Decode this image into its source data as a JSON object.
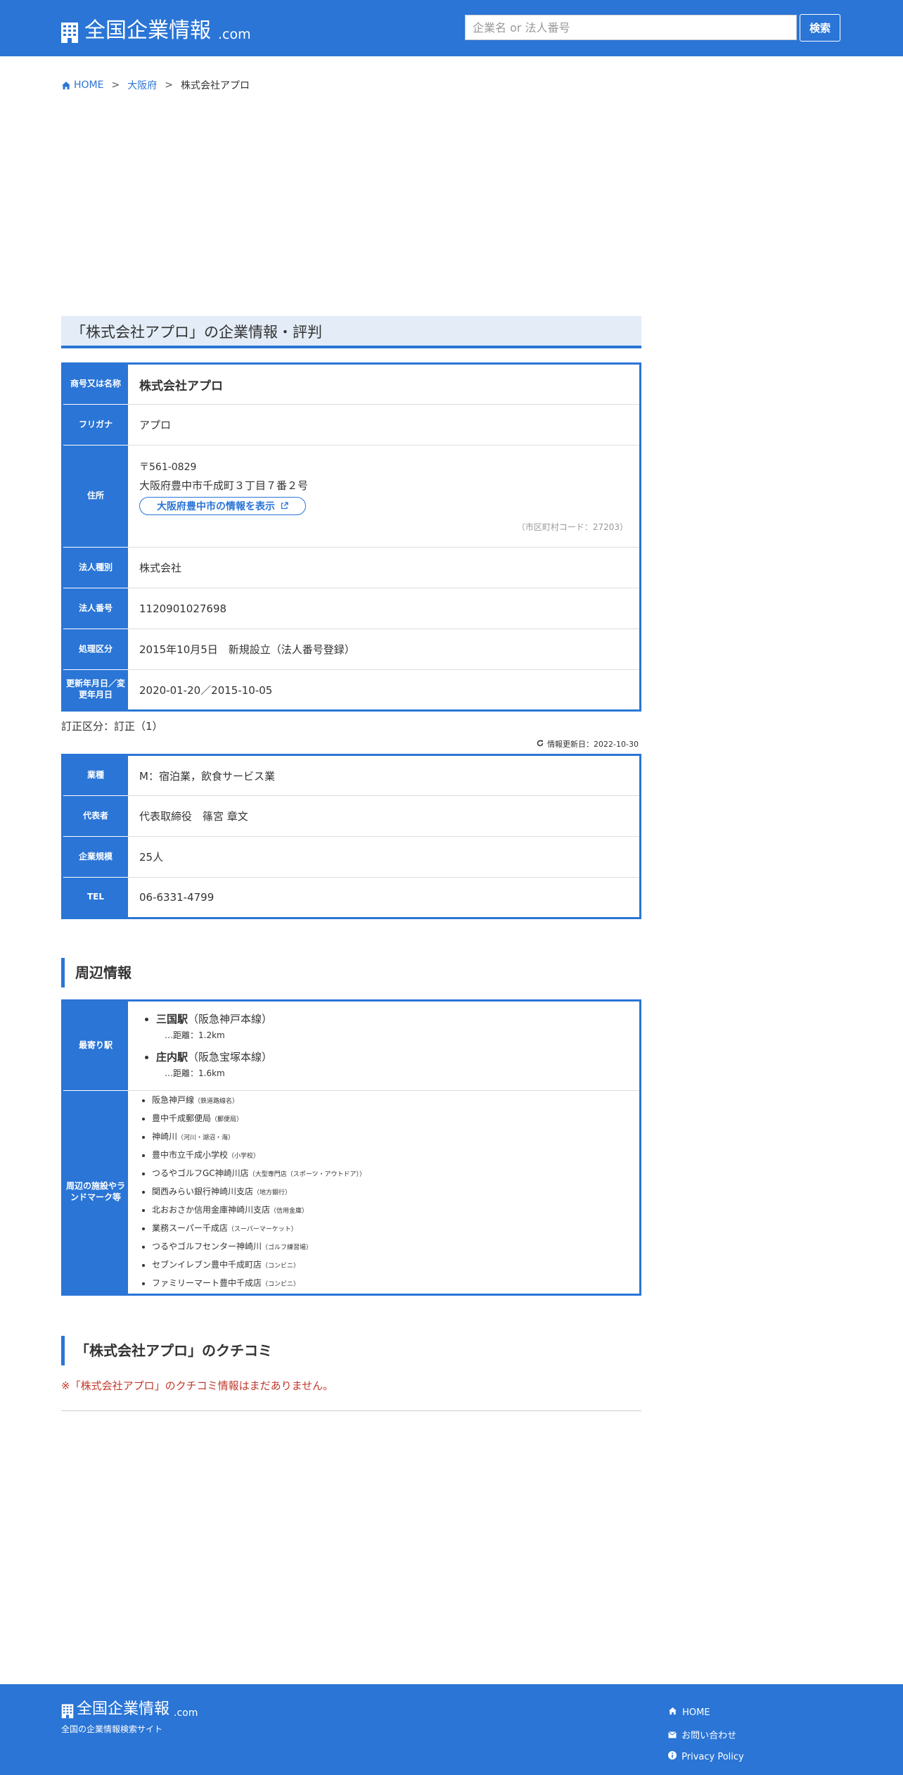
{
  "header": {
    "logo_text": "全国企業情報",
    "logo_suffix": ".com",
    "search_placeholder": "企業名 or 法人番号",
    "search_button": "検索"
  },
  "breadcrumb": {
    "home": "HOME",
    "sep": ">",
    "prefecture": "大阪府",
    "current": "株式会社アプロ"
  },
  "section_title": "「株式会社アプロ」の企業情報・評判",
  "basic": {
    "name_label": "商号又は名称",
    "name": "株式会社アプロ",
    "kana_label": "フリガナ",
    "kana": "アプロ",
    "address_label": "住所",
    "postal": "〒561-0829",
    "address": "大阪府豊中市千成町３丁目７番２号",
    "city_link": "大阪府豊中市の情報を表示",
    "muni_code": "（市区町村コード：27203）",
    "type_label": "法人種別",
    "type": "株式会社",
    "number_label": "法人番号",
    "number": "1120901027698",
    "process_label": "処理区分",
    "process": "2015年10月5日　新規設立（法人番号登録）",
    "updated_label": "更新年月日／変更年月日",
    "updated": "2020-01-20／2015-10-05"
  },
  "correction_note": "訂正区分：訂正（1）",
  "info_updated": "情報更新日：2022-10-30",
  "extra": {
    "industry_label": "業種",
    "industry": "M：宿泊業，飲食サービス業",
    "rep_label": "代表者",
    "rep": "代表取締役　篠宮 章文",
    "size_label": "企業規模",
    "size": "25人",
    "tel_label": "TEL",
    "tel": "06-6331-4799"
  },
  "nearby": {
    "title": "周辺情報",
    "station_label": "最寄り駅",
    "stations": [
      {
        "name": "三国駅",
        "line": "（阪急神戸本線）",
        "dist": "…距離：1.2km"
      },
      {
        "name": "庄内駅",
        "line": "（阪急宝塚本線）",
        "dist": "…距離：1.6km"
      }
    ],
    "landmark_label": "周辺の施設やランドマーク等",
    "landmarks": [
      {
        "name": "阪急神戸線",
        "cat": "（鉄道路線名）"
      },
      {
        "name": "豊中千成郵便局",
        "cat": "（郵便局）"
      },
      {
        "name": "神崎川",
        "cat": "（河川・湖沼・海）"
      },
      {
        "name": "豊中市立千成小学校",
        "cat": "（小学校）"
      },
      {
        "name": "つるやゴルフGC神崎川店",
        "cat": "（大型専門店（スポーツ・アウトドア））"
      },
      {
        "name": "関西みらい銀行神崎川支店",
        "cat": "（地方銀行）"
      },
      {
        "name": "北おおさか信用金庫神崎川支店",
        "cat": "（信用金庫）"
      },
      {
        "name": "業務スーパー千成店",
        "cat": "（スーパーマーケット）"
      },
      {
        "name": "つるやゴルフセンター神崎川",
        "cat": "（ゴルフ練習場）"
      },
      {
        "name": "セブンイレブン豊中千成町店",
        "cat": "（コンビニ）"
      },
      {
        "name": "ファミリーマート豊中千成店",
        "cat": "（コンビニ）"
      }
    ]
  },
  "reviews": {
    "title": "「株式会社アプロ」のクチコミ",
    "empty": "※「株式会社アプロ」のクチコミ情報はまだありません。"
  },
  "footer": {
    "logo_text": "全国企業情報",
    "logo_suffix": ".com",
    "tagline": "全国の企業情報検索サイト",
    "home": "HOME",
    "contact": "お問い合わせ",
    "privacy": "Privacy Policy"
  }
}
